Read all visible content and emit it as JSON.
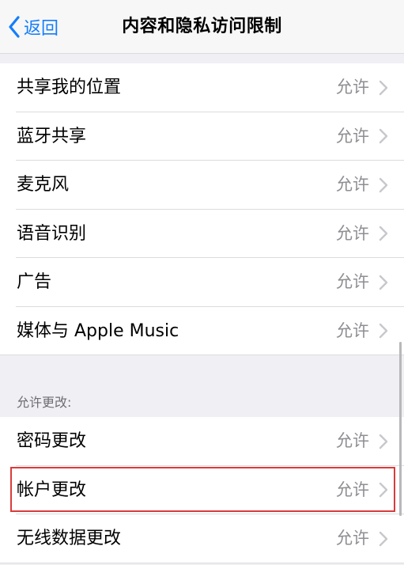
{
  "navbar": {
    "back_label": "返回",
    "title": "内容和隐私访问限制"
  },
  "privacy_group": {
    "items": [
      {
        "label": "共享我的位置",
        "value": "允许"
      },
      {
        "label": "蓝牙共享",
        "value": "允许"
      },
      {
        "label": "麦克风",
        "value": "允许"
      },
      {
        "label": "语音识别",
        "value": "允许"
      },
      {
        "label": "广告",
        "value": "允许"
      },
      {
        "label": "媒体与 Apple Music",
        "value": "允许"
      }
    ]
  },
  "changes_group": {
    "header": "允许更改:",
    "items": [
      {
        "label": "密码更改",
        "value": "允许"
      },
      {
        "label": "帐户更改",
        "value": "允许"
      },
      {
        "label": "无线数据更改",
        "value": "允许"
      }
    ]
  },
  "colors": {
    "accent": "#147efb",
    "highlight_border": "#d93b3b",
    "secondary_text": "#8e8e93",
    "grouped_background": "#efeff4"
  }
}
